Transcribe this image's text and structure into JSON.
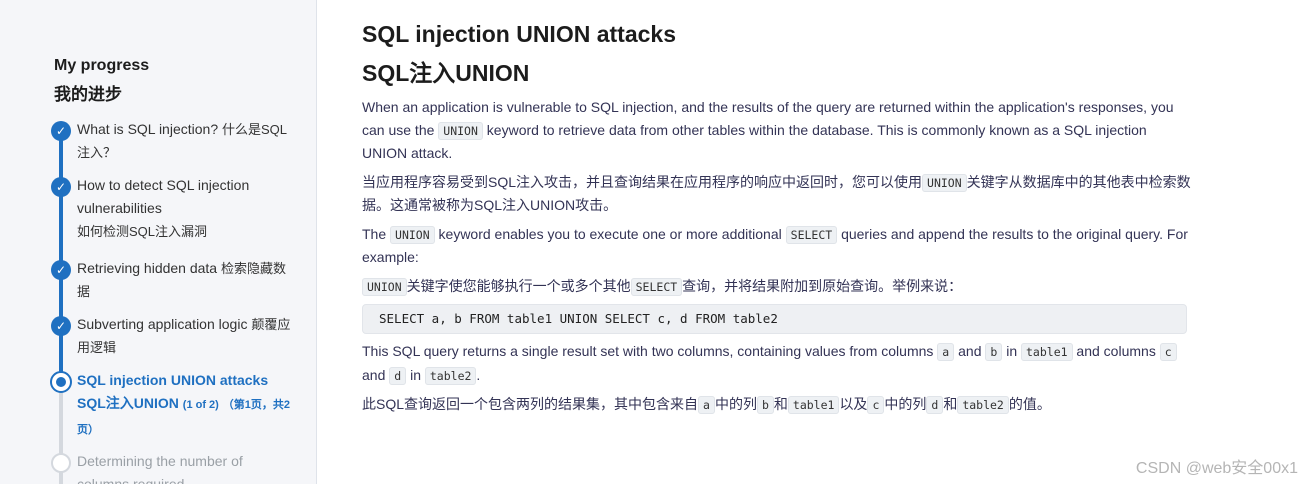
{
  "sidebar": {
    "title": "My progress",
    "title_cn": "我的进步",
    "steps": [
      {
        "label": "What is SQL injection?",
        "label_cn": "什么是SQL注入？"
      },
      {
        "label": "How to detect SQL injection vulnerabilities",
        "label_cn": "如何检测SQL注入漏洞"
      },
      {
        "label": "Retrieving hidden data",
        "label_cn": "检索隐藏数据"
      },
      {
        "label": "Subverting application logic",
        "label_cn": "颠覆应用逻辑"
      },
      {
        "label": "SQL injection UNION attacks",
        "label_cn": "SQL注入UNION",
        "page": "(1 of 2)",
        "page_cn": "（第1页，共2页）"
      },
      {
        "label": "Determining the number of columns required"
      }
    ]
  },
  "main": {
    "title": "SQL injection UNION attacks",
    "title_cn": "SQL注入UNION",
    "p1_a": "When an application is vulnerable to SQL injection, and the results of the query are returned within the application's responses, you can use the ",
    "p1_code": "UNION",
    "p1_b": " keyword to retrieve data from other tables within the database. This is commonly known as a SQL injection UNION attack.",
    "p1cn_a": "当应用程序容易受到SQL注入攻击，并且查询结果在应用程序的响应中返回时，您可以使用",
    "p1cn_code": "UNION",
    "p1cn_b": "关键字从数据库中的其他表中检索数据。这通常被称为SQL注入UNION攻击。",
    "p2_a": "The ",
    "p2_code1": "UNION",
    "p2_b": " keyword enables you to execute one or more additional ",
    "p2_code2": "SELECT",
    "p2_c": " queries and append the results to the original query. For example:",
    "p2cn_code1": "UNION",
    "p2cn_a": "关键字使您能够执行一个或多个其他",
    "p2cn_code2": "SELECT",
    "p2cn_b": "查询，并将结果附加到原始查询。举例来说：",
    "code_block": "SELECT a, b FROM table1 UNION SELECT c, d FROM table2",
    "p3_a": "This SQL query returns a single result set with two columns, containing values from columns ",
    "p3_c1": "a",
    "p3_and1": " and ",
    "p3_c2": "b",
    "p3_in1": " in ",
    "p3_c3": "table1",
    "p3_b": " and columns ",
    "p3_c4": "c",
    "p3_and2": " and ",
    "p3_c5": "d",
    "p3_in2": " in ",
    "p3_c6": "table2",
    "p3_end": ".",
    "p3cn_a": "此SQL查询返回一个包含两列的结果集，其中包含来自",
    "p3cn_c1": "a",
    "p3cn_b": "中的列",
    "p3cn_c2": "b",
    "p3cn_c": "和",
    "p3cn_c3": "table1",
    "p3cn_d": "以及",
    "p3cn_c4": "c",
    "p3cn_e": "中的列",
    "p3cn_c5": "d",
    "p3cn_f": "和",
    "p3cn_c6": "table2",
    "p3cn_g": "的值。"
  },
  "watermark": "CSDN @web安全00x1",
  "colors": {
    "accent": "#1f70c1",
    "text": "#333355",
    "code_bg": "#eef1f4"
  }
}
